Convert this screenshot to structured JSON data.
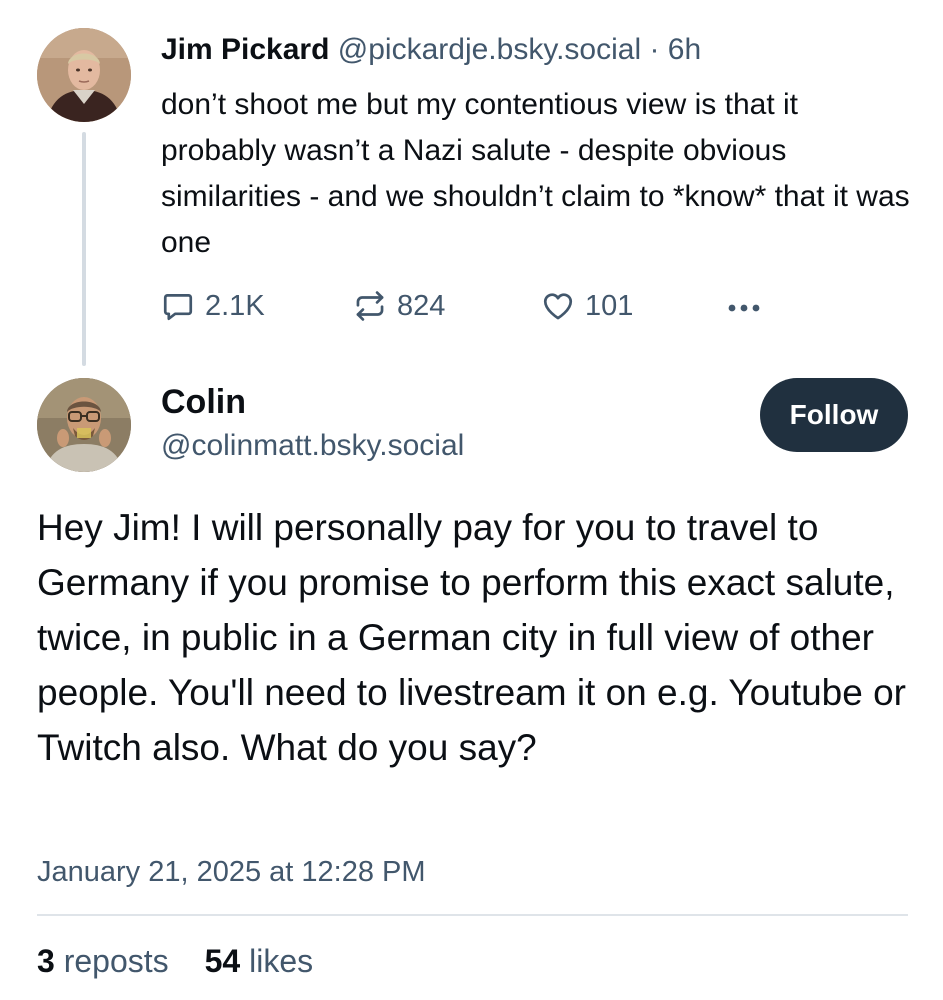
{
  "parent_post": {
    "author_name": "Jim Pickard",
    "handle": "@pickardje.bsky.social",
    "separator": " · ",
    "time": "6h",
    "text": "don’t shoot me but my contentious view is that it probably wasn’t a Nazi salute - despite obvious similarities - and we shouldn’t claim to *know* that it was one",
    "stats": {
      "replies": "2.1K",
      "reposts": "824",
      "likes": "101"
    }
  },
  "post": {
    "author_name": "Colin",
    "handle": "@colinmatt.bsky.social",
    "follow_label": "Follow",
    "text": "Hey Jim! I will personally pay for you to travel to Germany if you promise to perform this exact salute, twice, in public in a German city in full view of other people. You'll need to livestream it on e.g. Youtube or Twitch also. What do you say?",
    "timestamp": "January 21, 2025 at 12:28 PM",
    "reposts_count": "3",
    "reposts_label": "reposts",
    "likes_count": "54",
    "likes_label": "likes"
  },
  "icons": {
    "reply": "speech-bubble-icon",
    "repost": "repost-arrows-icon",
    "like": "heart-icon",
    "more": "ellipsis-icon"
  },
  "colors": {
    "text": "#0b0f14",
    "secondary": "#42576c",
    "follow_button": "#20303f",
    "thread_line": "#d4dbe2",
    "divider": "#dfe4e9"
  }
}
